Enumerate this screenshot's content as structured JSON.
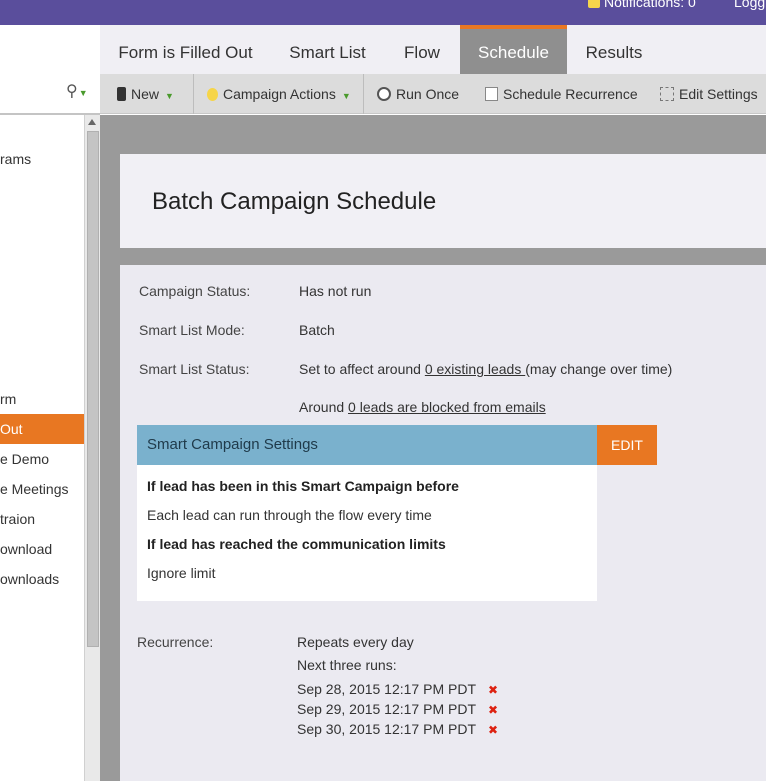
{
  "topbar": {
    "notifications": "Notifications: 0",
    "login": "Logg"
  },
  "tabs": [
    "Form is Filled Out",
    "Smart List",
    "Flow",
    "Schedule",
    "Results"
  ],
  "active_tab": "Schedule",
  "toolbar": {
    "new": "New",
    "campaign_actions": "Campaign Actions",
    "run_once": "Run Once",
    "schedule_recurrence": "Schedule Recurrence",
    "edit_settings": "Edit Settings"
  },
  "sidebar": {
    "items": [
      "rams",
      "rm",
      "Out",
      "e Demo",
      "e Meetings",
      "traion",
      "ownload",
      "ownloads"
    ]
  },
  "main": {
    "title": "Batch Campaign Schedule",
    "campaign_status_label": "Campaign Status:",
    "campaign_status": "Has not run",
    "smart_list_mode_label": "Smart List Mode:",
    "smart_list_mode": "Batch",
    "smart_list_status_label": "Smart List Status:",
    "smart_list_status_pre": "Set to affect around ",
    "smart_list_status_link": "0 existing leads ",
    "smart_list_status_post": "(may change over time)",
    "blocked_pre": "Around ",
    "blocked_link": "0 leads are blocked from emails",
    "settings": {
      "title": "Smart Campaign Settings",
      "edit": "EDIT",
      "q1": "If lead has been in this Smart Campaign before",
      "a1": "Each lead can run through the flow every time",
      "q2": "If lead has reached the communication limits",
      "a2": "Ignore limit"
    },
    "recurrence_label": "Recurrence:",
    "recurrence": "Repeats every day",
    "next_runs_label": "Next three runs:",
    "runs": [
      "Sep 28, 2015 12:17 PM PDT",
      "Sep 29, 2015 12:17 PM PDT",
      "Sep 30, 2015 12:17 PM PDT"
    ],
    "delete_glyph": "✖"
  },
  "colors": {
    "purple": "#5a4e9c",
    "orange": "#e87722",
    "settings_blue": "#7ab1cd"
  }
}
